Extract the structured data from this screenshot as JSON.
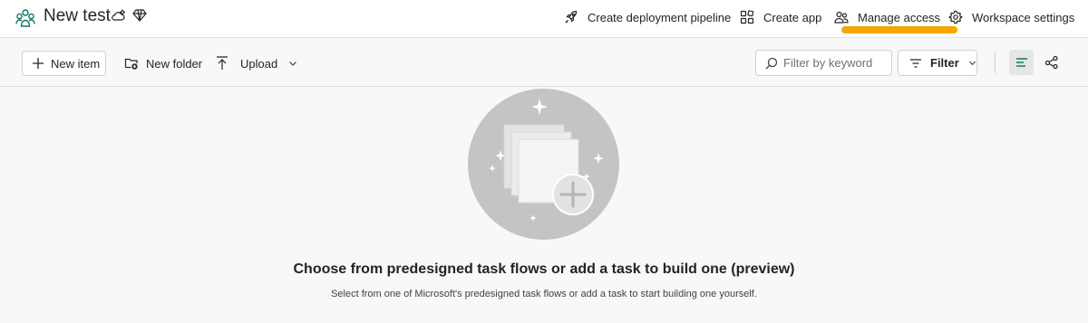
{
  "workspace": {
    "title": "New test",
    "icon": "workspace-people-icon",
    "badges": [
      "cloud-gear-badge-icon",
      "premium-diamond-icon"
    ]
  },
  "header_actions": [
    {
      "label": "Create deployment pipeline",
      "icon": "rocket-icon"
    },
    {
      "label": "Create app",
      "icon": "app-grid-icon"
    },
    {
      "label": "Manage access",
      "icon": "people-icon",
      "highlighted": true
    },
    {
      "label": "Workspace settings",
      "icon": "gear-icon"
    }
  ],
  "toolbar": {
    "new_item": "New item",
    "new_folder": "New folder",
    "upload": "Upload",
    "search_placeholder": "Filter by keyword",
    "filter": "Filter"
  },
  "views": [
    "list-view-icon",
    "lineage-view-icon"
  ],
  "empty_state": {
    "title": "Choose from predesigned task flows or add a task to build one (preview)",
    "subtitle": "Select from one of Microsoft's predesigned task flows or add a task to start building one yourself."
  },
  "colors": {
    "highlight": "#f7a600",
    "accent": "#117865",
    "background": "#f8f8f8"
  }
}
